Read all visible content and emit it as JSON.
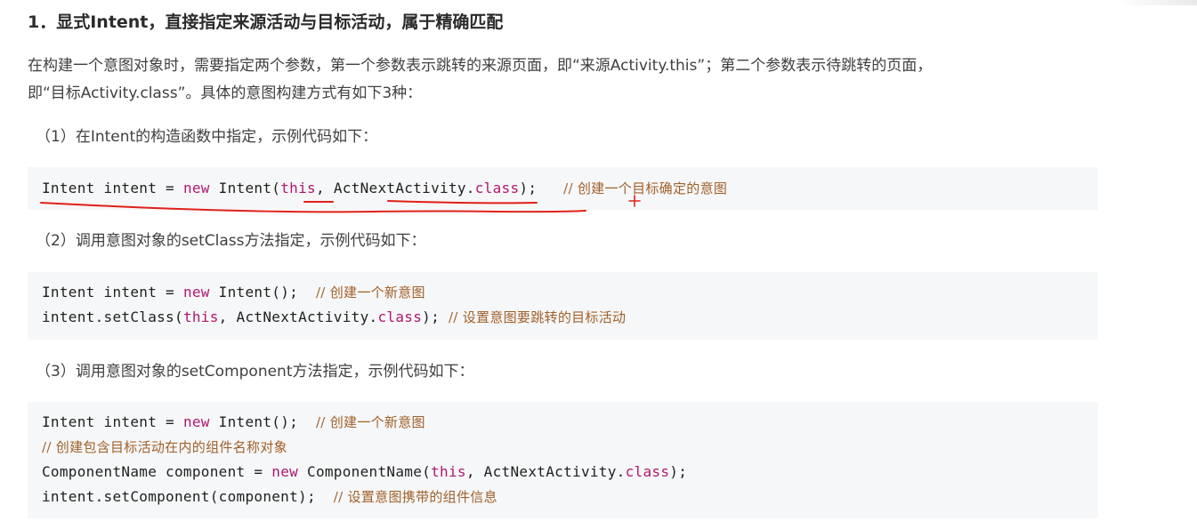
{
  "heading": "1．显式Intent，直接指定来源活动与目标活动，属于精确匹配",
  "intro": {
    "line1": "在构建一个意图对象时，需要指定两个参数，第一个参数表示跳转的来源页面，即“来源Activity.this”；第二个参数表示待跳转的页面，",
    "line2": "即“目标Activity.class”。具体的意图构建方式有如下3种："
  },
  "sections": [
    {
      "label": "（1）在Intent的构造函数中指定，示例代码如下：",
      "code": [
        {
          "pre": "Intent intent = ",
          "kw": "new",
          "mid": " Intent(",
          "kw2": "this",
          "mid2": ", ActNextActivity.",
          "kw3": "class",
          "post": ");  ",
          "comment": "// 创建一个目标确定的意图"
        }
      ]
    },
    {
      "label": "（2）调用意图对象的setClass方法指定，示例代码如下：",
      "code": [
        {
          "pre": "Intent intent = ",
          "kw": "new",
          "mid": " Intent();  ",
          "comment": "// 创建一个新意图"
        },
        {
          "pre": "intent.setClass(",
          "kw": "this",
          "mid": ", ActNextActivity.",
          "kw2": "class",
          "post": "); ",
          "comment": "// 设置意图要跳转的目标活动"
        }
      ]
    },
    {
      "label": "（3）调用意图对象的setComponent方法指定，示例代码如下：",
      "code": [
        {
          "pre": "Intent intent = ",
          "kw": "new",
          "mid": " Intent();  ",
          "comment": "// 创建一个新意图"
        },
        {
          "comment": "// 创建包含目标活动在内的组件名称对象"
        },
        {
          "pre": "ComponentName component = ",
          "kw": "new",
          "mid": " ComponentName(",
          "kw2": "this",
          "mid2": ", ActNextActivity.",
          "kw3": "class",
          "post": ");"
        },
        {
          "pre": "intent.setComponent(component);  ",
          "comment": "// 设置意图携带的组件信息"
        }
      ]
    }
  ],
  "colors": {
    "keyword": "#b0176f",
    "comment": "#a0602a",
    "annotation": "#e0201a",
    "code_bg": "#f6f7f8"
  }
}
